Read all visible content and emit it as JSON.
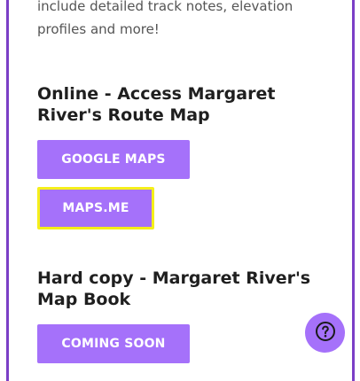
{
  "intro": {
    "text": "include detailed track notes, elevation profiles and more!"
  },
  "online": {
    "heading": "Online - Access Margaret River's Route Map",
    "buttons": [
      {
        "label": "Google Maps"
      },
      {
        "label": "Maps.me"
      }
    ]
  },
  "hardcopy": {
    "heading": "Hard copy - Margaret River's Map Book",
    "button_label": "Coming Soon"
  },
  "help": {
    "icon": "question-circle-icon"
  },
  "colors": {
    "accent": "#a571fa",
    "frame": "#7b3fc6",
    "focus_highlight": "#f5ef1a",
    "heading_text": "#1f1f1f",
    "body_text": "#555555"
  }
}
